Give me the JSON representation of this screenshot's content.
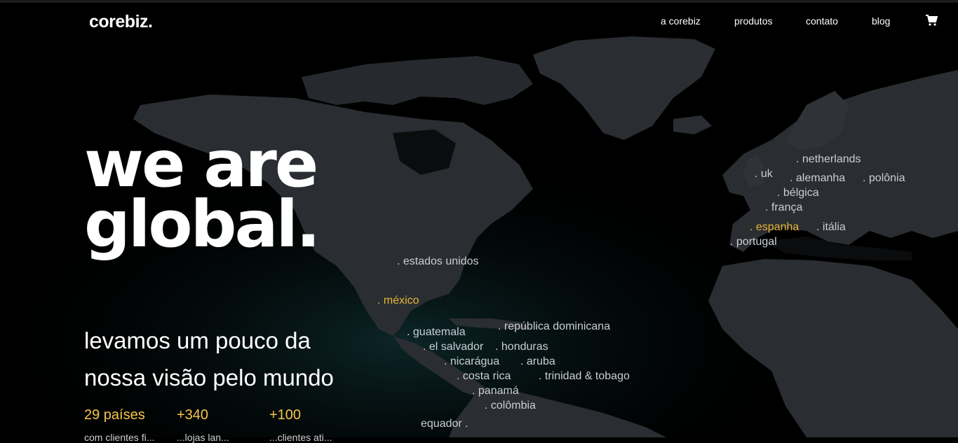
{
  "header": {
    "logo_text": "corebiz",
    "logo_dot": ".",
    "nav": [
      "a corebiz",
      "produtos",
      "contato",
      "blog"
    ],
    "cart_icon": "cart-icon"
  },
  "hero": {
    "title_line1": "we are",
    "title_line2": "global.",
    "subtitle_line1": "levamos um pouco da",
    "subtitle_line2": "nossa visão pelo mundo"
  },
  "stats": [
    {
      "value": "29 países",
      "desc": "com clientes fi..."
    },
    {
      "value": "+340",
      "desc": "...lojas lan..."
    },
    {
      "value": "+100",
      "desc": "...clientes ati..."
    }
  ],
  "countries": {
    "netherlands": ". netherlands",
    "uk": ". uk",
    "alemanha": ". alemanha",
    "polonia": ". polônia",
    "belgica": ". bélgica",
    "franca": ". frança",
    "espanha": ". espanha",
    "italia": ". itália",
    "portugal": ". portugal",
    "estados_unidos": ". estados unidos",
    "mexico": ". méxico",
    "republica_dominicana": ". república dominicana",
    "guatemala": ". guatemala",
    "el_salvador": ". el salvador",
    "honduras": ". honduras",
    "nicaragua": ". nicarágua",
    "aruba": ". aruba",
    "costa_rica": ". costa rica",
    "trinidad": ". trinidad  & tobago",
    "panama": ". panamá",
    "colombia": ". colômbia",
    "equador": "equador ."
  },
  "colors": {
    "background": "#000000",
    "accent": "#f6c64a",
    "highlight_country": "#e8b63a",
    "country_text": "#c9cfd6",
    "land": "#2a2d31"
  }
}
